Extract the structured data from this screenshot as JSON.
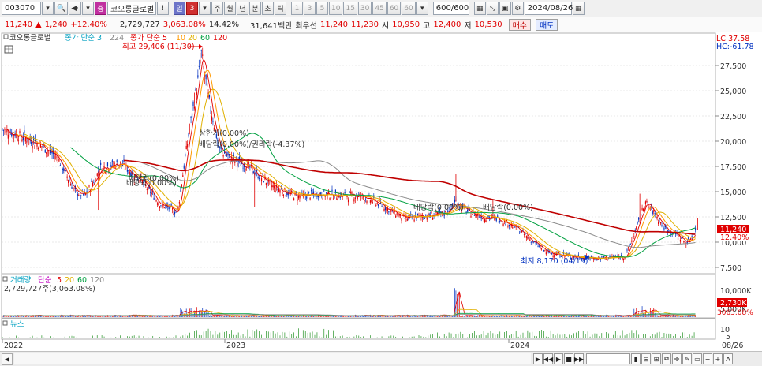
{
  "toolbar": {
    "code": "003070",
    "stock_name": "코오롱글로벌",
    "alert": "!",
    "period_day": "일",
    "period_num": "3",
    "periods": [
      "주",
      "월",
      "년",
      "분",
      "초",
      "틱"
    ],
    "intervals": [
      "1",
      "3",
      "5",
      "10",
      "15",
      "30",
      "45",
      "60",
      "60"
    ],
    "count": "600/600",
    "date": "2024/08/26"
  },
  "infobar": {
    "price": "11,240",
    "change": "1,240",
    "change_pct": "+12.40%",
    "volume": "2,729,727",
    "volume_ratio": "3,063.08%",
    "turnover": "14.42%",
    "amount": "31,641백만",
    "best_ask_label": "최우선",
    "best_ask": "11,240",
    "best_bid": "11,230",
    "open_label": "시",
    "open": "10,950",
    "high_label": "고",
    "high": "12,400",
    "low_label": "저",
    "low": "10,530",
    "buy_label": "매수",
    "sell_label": "매도"
  },
  "legend": {
    "name": "코오롱글로벌",
    "close_ma": "종가 단순 3",
    "close_ma_2": "224",
    "price_ma": "종가 단순 5",
    "ma10": "10",
    "ma20": "20",
    "ma60": "60",
    "ma120": "120",
    "lc": "LC:37.58",
    "hc": "HC:-61.78"
  },
  "annotations": {
    "high": "최고 29,406 (11/30)",
    "low": "최저 8,170 (04/19)",
    "upper_limit": "상한가(0.00%)",
    "dividend_combo": "배당락(0.00%)/권리락(-4.37%)",
    "dividend_1": "배당락(0.00%)",
    "dividend_2": "배당락(0.00%)",
    "dividend_3": "배당락(0.00%)",
    "dividend_early": "배당락(0.00%)"
  },
  "price_axis": {
    "ticks": [
      "27,500",
      "25,000",
      "22,500",
      "20,000",
      "17,500",
      "15,000",
      "12,500",
      "10,000",
      "7,500"
    ],
    "current_price": "11,240",
    "current_pct": "12.40%"
  },
  "volume_panel": {
    "label": "거래량",
    "ma": "단순",
    "ma5": "5",
    "ma20": "20",
    "ma60": "60",
    "ma120": "120",
    "value": "2,729,727주(3,063.08%)",
    "ticks": [
      "10,000K",
      "5,000K"
    ],
    "current": "2,730K",
    "current_pct": "3063.08%"
  },
  "news_panel": {
    "label": "뉴스",
    "ticks": [
      "10",
      "5"
    ]
  },
  "x_axis": {
    "labels": [
      "2022",
      "2023",
      "2024"
    ],
    "end_label": "08/26"
  },
  "colors": {
    "up": "#e00000",
    "down": "#0030c0",
    "ma5": "#e00000",
    "ma10": "#ff9900",
    "ma20": "#e0b000",
    "ma60": "#00a040",
    "ma120": "#8a8a8a",
    "ma224": "#c00000"
  }
}
